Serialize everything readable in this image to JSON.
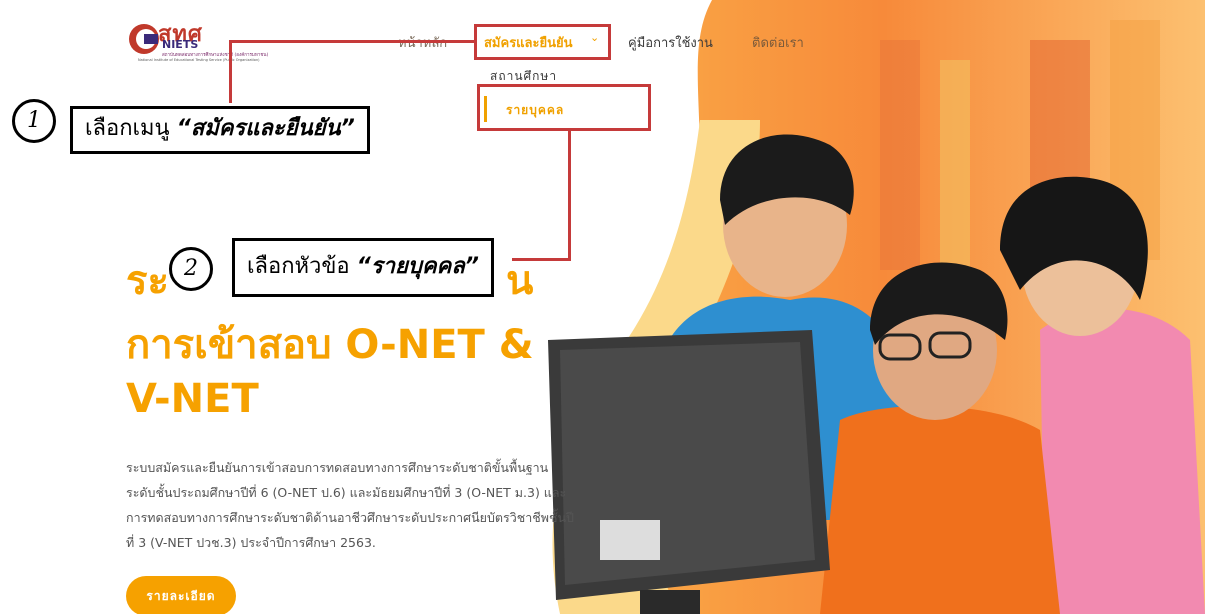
{
  "logo": {
    "thai": "สทศ",
    "english": "NIETS",
    "sub_thai": "สถาบันทดสอบทางการศึกษาแห่งชาติ (องค์การมหาชน)",
    "sub_english": "National Institute of Educational Testing Service (Public Organization)"
  },
  "nav": {
    "home": "หน้าหลัก",
    "register": "สมัครและยืนยัน",
    "chevron": "⌄",
    "manual": "คู่มือการใช้งาน",
    "contact": "ติดต่อเรา"
  },
  "dropdown": {
    "items": [
      "สถานศึกษา",
      "รายบุคคล"
    ]
  },
  "annotations": {
    "step1": {
      "number": "1",
      "prefix": "เลือกเมนู ",
      "highlight": "“สมัครและยืนยัน”"
    },
    "step2": {
      "number": "2",
      "prefix": "เลือกหัวข้อ ",
      "highlight": "“รายบุคคล”"
    }
  },
  "hero": {
    "title_line1_start": "ระ",
    "title_line1_end": "น",
    "title_line2": "การเข้าสอบ O-NET &",
    "title_line3": "V-NET",
    "description": "ระบบสมัครและยืนยันการเข้าสอบการทดสอบทางการศึกษาระดับชาติขั้นพื้นฐานระดับชั้นประถมศึกษาปีที่ 6 (O-NET ป.6) และมัธยมศึกษาปีที่ 3 (O-NET ม.3) และ การทดสอบทางการศึกษาระดับชาติด้านอาชีวศึกษาระดับประกาศนียบัตรวิชาชีพชั้นปีที่ 3 (V-NET ปวช.3) ประจำปีการศึกษา 2563.",
    "detail_button": "รายละเอียด"
  },
  "colors": {
    "accent": "#f6a100",
    "guide_red": "#c53a3a",
    "background_orange": "#fcb84a"
  }
}
